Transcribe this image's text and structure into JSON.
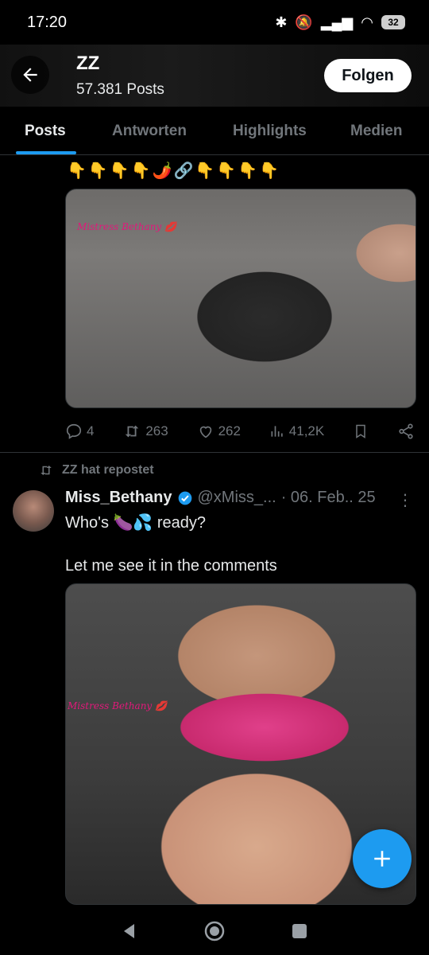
{
  "status_bar": {
    "time": "17:20",
    "battery": "32"
  },
  "header": {
    "name": "ZZ",
    "posts_count": "57.381 Posts",
    "follow_label": "Folgen"
  },
  "tabs": [
    "Posts",
    "Antworten",
    "Highlights",
    "Medien"
  ],
  "post1": {
    "emoji_line": "👇👇👇👇🌶️🔗👇👇👇👇",
    "watermark": "Mistress Bethany 💋",
    "stats": {
      "replies": "4",
      "reposts": "263",
      "likes": "262",
      "views": "41,2K"
    }
  },
  "post2": {
    "repost_label": "ZZ hat repostet",
    "author": "Miss_Bethany",
    "handle": "@xMiss_...",
    "date": "· 06. Feb.. 25",
    "text_line1": "Who's 🍆💦 ready?",
    "text_line2": "Let me see it in the comments",
    "watermark": "Mistress Bethany 💋"
  },
  "colors": {
    "accent": "#1d9bf0",
    "background": "#000000",
    "muted": "#71767b"
  },
  "icons": [
    "back-arrow-icon",
    "reply-icon",
    "repost-icon",
    "like-icon",
    "views-icon",
    "bookmark-icon",
    "share-icon",
    "verified-icon",
    "more-icon",
    "plus-icon"
  ]
}
